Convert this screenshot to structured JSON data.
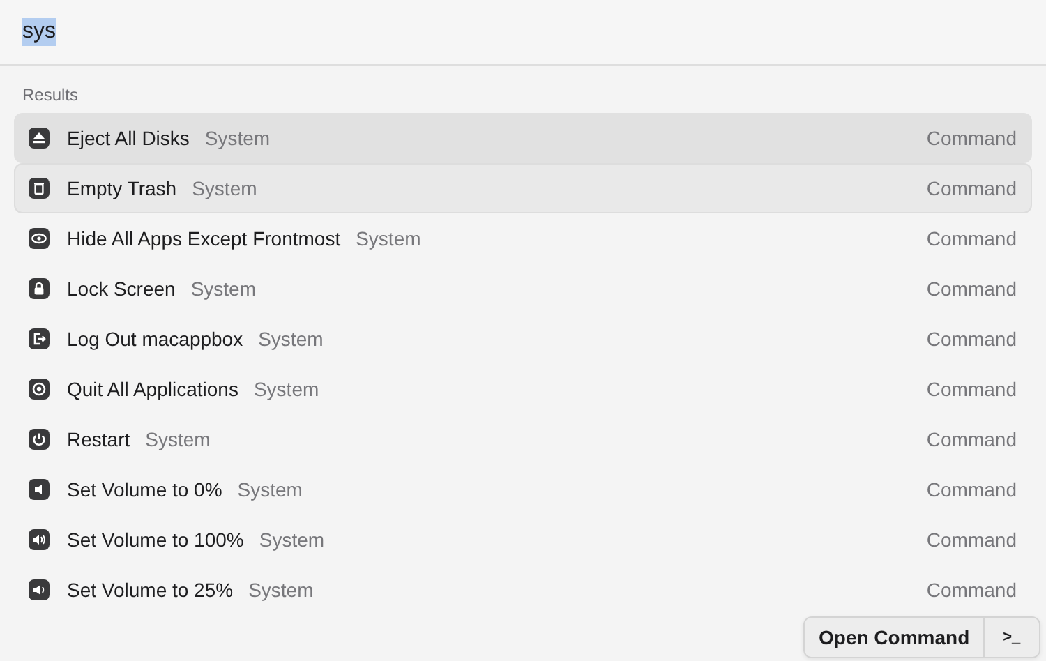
{
  "search": {
    "value": "sys",
    "text_selected": true
  },
  "section_title": "Results",
  "results": [
    {
      "title": "Eject All Disks",
      "subtitle": "System",
      "type": "Command",
      "selected": true,
      "hovered": false
    },
    {
      "title": "Empty Trash",
      "subtitle": "System",
      "type": "Command",
      "selected": false,
      "hovered": true
    },
    {
      "title": "Hide All Apps Except Frontmost",
      "subtitle": "System",
      "type": "Command",
      "selected": false,
      "hovered": false
    },
    {
      "title": "Lock Screen",
      "subtitle": "System",
      "type": "Command",
      "selected": false,
      "hovered": false
    },
    {
      "title": "Log Out macappbox",
      "subtitle": "System",
      "type": "Command",
      "selected": false,
      "hovered": false
    },
    {
      "title": "Quit All Applications",
      "subtitle": "System",
      "type": "Command",
      "selected": false,
      "hovered": false
    },
    {
      "title": "Restart",
      "subtitle": "System",
      "type": "Command",
      "selected": false,
      "hovered": false
    },
    {
      "title": "Set Volume to 0%",
      "subtitle": "System",
      "type": "Command",
      "selected": false,
      "hovered": false
    },
    {
      "title": "Set Volume to 100%",
      "subtitle": "System",
      "type": "Command",
      "selected": false,
      "hovered": false
    },
    {
      "title": "Set Volume to 25%",
      "subtitle": "System",
      "type": "Command",
      "selected": false,
      "hovered": false
    }
  ],
  "action_bar": {
    "primary": "Open Command",
    "shortcut": ">_"
  }
}
